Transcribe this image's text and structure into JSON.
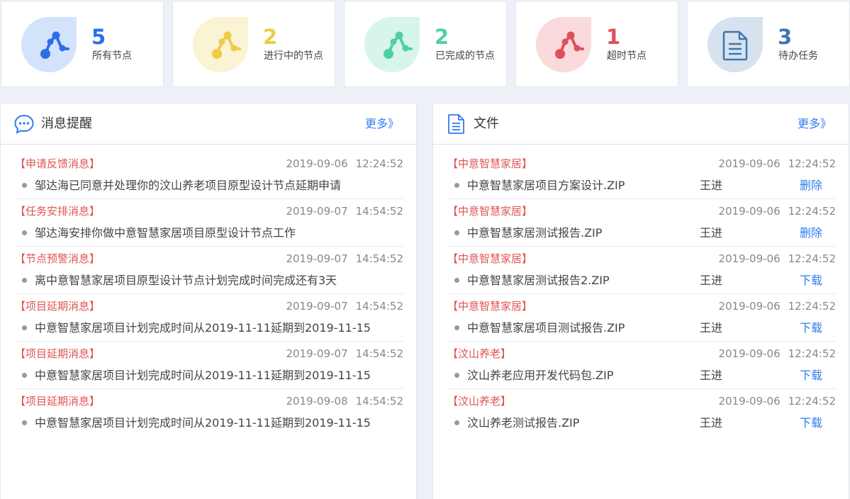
{
  "stats": [
    {
      "value": "5",
      "label": "所有节点",
      "color": "#2b6ee8",
      "bg": "#d2e3fb",
      "icon": "nodes-icon"
    },
    {
      "value": "2",
      "label": "进行中的节点",
      "color": "#ebcd45",
      "bg": "#faf3d4",
      "icon": "nodes-icon"
    },
    {
      "value": "2",
      "label": "已完成的节点",
      "color": "#4fd0a3",
      "bg": "#d8f5eb",
      "icon": "nodes-icon"
    },
    {
      "value": "1",
      "label": "超时节点",
      "color": "#e0505a",
      "bg": "#fadadc",
      "icon": "nodes-icon"
    },
    {
      "value": "3",
      "label": "待办任务",
      "color": "#3e77b0",
      "bg": "#d7e2ee",
      "icon": "document-icon"
    }
  ],
  "messages": {
    "title": "消息提醒",
    "more": "更多》",
    "items": [
      {
        "tag": "【申请反馈消息】",
        "date": "2019-09-06",
        "time": "12:24:52",
        "text": "邹达海已同意并处理你的汶山养老项目原型设计节点延期申请"
      },
      {
        "tag": "【任务安排消息】",
        "date": "2019-09-07",
        "time": "14:54:52",
        "text": "邹达海安排你做中意智慧家居项目原型设计节点工作"
      },
      {
        "tag": "【节点预警消息】",
        "date": "2019-09-07",
        "time": "14:54:52",
        "text": "离中意智慧家居项目原型设计节点计划完成时间完成还有3天"
      },
      {
        "tag": "【项目延期消息】",
        "date": "2019-09-07",
        "time": "14:54:52",
        "text": "中意智慧家居项目计划完成时间从2019-11-11延期到2019-11-15"
      },
      {
        "tag": "【项目延期消息】",
        "date": "2019-09-07",
        "time": "14:54:52",
        "text": "中意智慧家居项目计划完成时间从2019-11-11延期到2019-11-15"
      },
      {
        "tag": "【项目延期消息】",
        "date": "2019-09-08",
        "time": "14:54:52",
        "text": "中意智慧家居项目计划完成时间从2019-11-11延期到2019-11-15"
      }
    ]
  },
  "files": {
    "title": "文件",
    "more": "更多》",
    "items": [
      {
        "tag": "【中意智慧家居】",
        "date": "2019-09-06",
        "time": "12:24:52",
        "name": "中意智慧家居项目方案设计.ZIP",
        "owner": "王进",
        "action": "删除"
      },
      {
        "tag": "【中意智慧家居】",
        "date": "2019-09-06",
        "time": "12:24:52",
        "name": "中意智慧家居测试报告.ZIP",
        "owner": "王进",
        "action": "删除"
      },
      {
        "tag": "【中意智慧家居】",
        "date": "2019-09-06",
        "time": "12:24:52",
        "name": "中意智慧家居测试报告2.ZIP",
        "owner": "王进",
        "action": "下载"
      },
      {
        "tag": "【中意智慧家居】",
        "date": "2019-09-06",
        "time": "12:24:52",
        "name": "中意智慧家居项目测试报告.ZIP",
        "owner": "王进",
        "action": "下载"
      },
      {
        "tag": "【汶山养老】",
        "date": "2019-09-06",
        "time": "12:24:52",
        "name": "汶山养老应用开发代码包.ZIP",
        "owner": "王进",
        "action": "下载"
      },
      {
        "tag": "【汶山养老】",
        "date": "2019-09-06",
        "time": "12:24:52",
        "name": "汶山养老测试报告.ZIP",
        "owner": "王进",
        "action": "下载"
      }
    ]
  }
}
